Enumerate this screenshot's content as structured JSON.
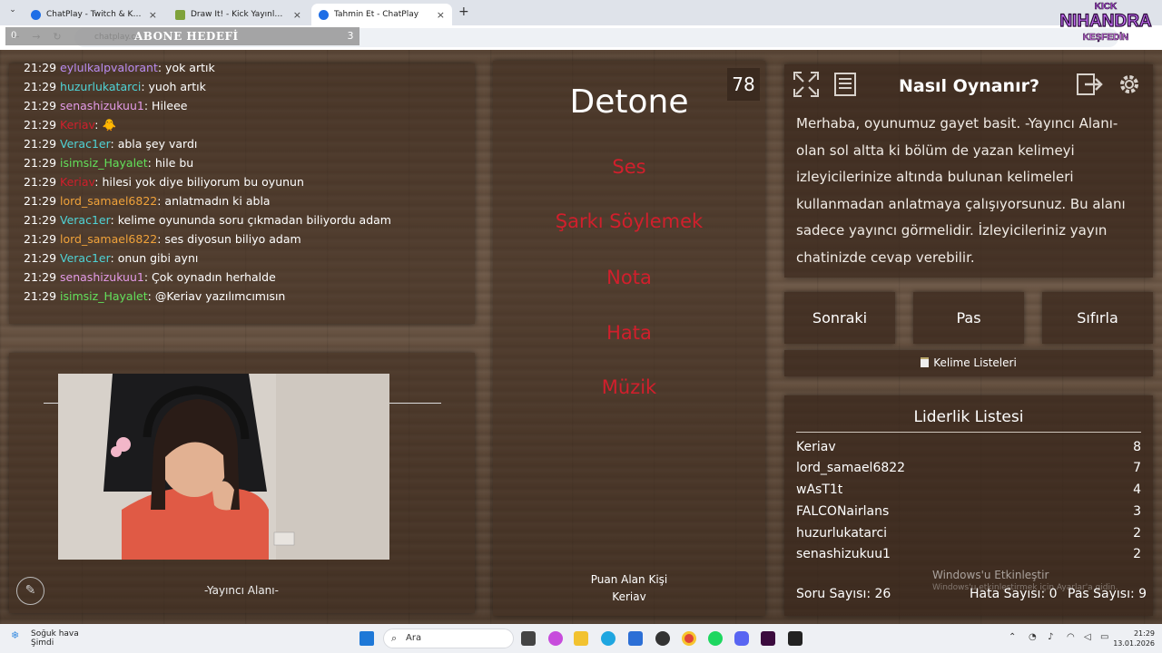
{
  "browser": {
    "tabs": [
      {
        "label": "ChatPlay - Twitch & Kick İzleyici",
        "fav_color": "#1e6ee6",
        "active": false
      },
      {
        "label": "Draw It! - Kick Yayınları İçin Çizim",
        "fav_color": "#7fa23b",
        "active": false
      },
      {
        "label": "Tahmin Et - ChatPlay",
        "fav_color": "#1e6ee6",
        "active": true
      }
    ],
    "url": "chatplay.co...",
    "new_tab": "+",
    "tab_close": "×"
  },
  "overlay": {
    "abone_title": "ABONE HEDEFİ",
    "abone_count": "3",
    "abone_left": "0",
    "logo_top": "KICK",
    "logo_main": "NIHANDRA",
    "logo_sub": "KEŞFEDİN"
  },
  "chat": {
    "messages": [
      {
        "time": "21:29",
        "user": "eylulkalpvalorant",
        "color": "#b98cf0",
        "text": ": yok artık"
      },
      {
        "time": "21:29",
        "user": "huzurlukatarci",
        "color": "#4fd3d6",
        "text": ": yuoh artık"
      },
      {
        "time": "21:29",
        "user": "senashizukuu1",
        "color": "#e49be8",
        "text": ": Hileee"
      },
      {
        "time": "21:29",
        "user": "Keriav",
        "color": "#d11f2c",
        "text": ": 🐥"
      },
      {
        "time": "21:29",
        "user": "Verac1er",
        "color": "#4fd3d6",
        "text": ": abla şey vardı"
      },
      {
        "time": "21:29",
        "user": "isimsiz_Hayalet",
        "color": "#62e05a",
        "text": ": hile bu"
      },
      {
        "time": "21:29",
        "user": "Keriav",
        "color": "#d11f2c",
        "text": ": hilesi yok diye biliyorum bu oyunun"
      },
      {
        "time": "21:29",
        "user": "lord_samael6822",
        "color": "#f0a23a",
        "text": ": anlatmadın ki abla"
      },
      {
        "time": "21:29",
        "user": "Verac1er",
        "color": "#4fd3d6",
        "text": ": kelime oyununda soru çıkmadan biliyordu adam"
      },
      {
        "time": "21:29",
        "user": "lord_samael6822",
        "color": "#f0a23a",
        "text": ": ses diyosun biliyo adam"
      },
      {
        "time": "21:29",
        "user": "Verac1er",
        "color": "#4fd3d6",
        "text": ": onun gibi aynı"
      },
      {
        "time": "21:29",
        "user": "senashizukuu1",
        "color": "#e49be8",
        "text": ": Çok oynadın herhalde"
      },
      {
        "time": "21:29",
        "user": "isimsiz_Hayalet",
        "color": "#62e05a",
        "text": ": @Keriav yazılımcımısın"
      }
    ]
  },
  "cam": {
    "label": "-Yayıncı Alanı-",
    "icon": "pencil-icon"
  },
  "game": {
    "counter": "78",
    "word": "Detone",
    "taboo": [
      "Ses",
      "Şarkı Söylemek",
      "Nota",
      "Hata",
      "Müzik"
    ],
    "taboo_color": "#d11f2c",
    "score_title": "Puan Alan Kişi",
    "score_user": "Keriav"
  },
  "help": {
    "title": "Nasıl Oynanır?",
    "text": "Merhaba, oyunumuz gayet basit. -Yayıncı Alanı- olan sol altta ki bölüm de yazan kelimeyi izleyicilerinize altında bulunan kelimeleri kullanmadan anlatmaya çalışıyorsunuz. Bu alanı sadece yayıncı görmelidir. İzleyicileriniz yayın chatinizde cevap verebilir."
  },
  "actions": {
    "next": "Sonraki",
    "pass": "Pas",
    "reset": "Sıfırla",
    "word_lists": "Kelime Listeleri"
  },
  "leaderboard": {
    "title": "Liderlik Listesi",
    "rows": [
      {
        "name": "Keriav",
        "score": "8"
      },
      {
        "name": "lord_samael6822",
        "score": "7"
      },
      {
        "name": "wAsT1t",
        "score": "4"
      },
      {
        "name": "FALCONairlans",
        "score": "3"
      },
      {
        "name": "huzurlukatarci",
        "score": "2"
      },
      {
        "name": "senashizukuu1",
        "score": "2"
      }
    ],
    "question_count": "Soru Sayısı: 26",
    "error_count": "Hata Sayısı: 0",
    "pass_count": "Pas Sayısı: 9"
  },
  "windows": {
    "watermark_title": "Windows'u Etkinleştir",
    "watermark_sub": "Windows'u etkinleştirmek için Ayarlar'a gidin.",
    "weather_1": "Soğuk hava",
    "weather_2": "Şimdi",
    "search": "Ara",
    "time": "21:29",
    "date": "13.01.2026"
  }
}
